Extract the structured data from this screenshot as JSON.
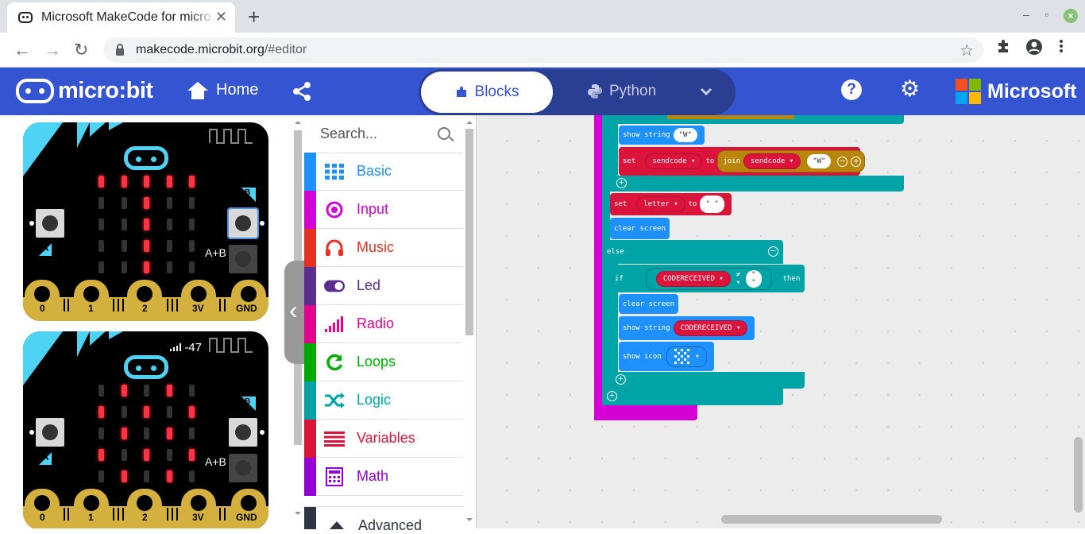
{
  "browser": {
    "tab_title": "Microsoft MakeCode for micro:bit",
    "tab_close": "✕",
    "new_tab": "+",
    "url_host": "makecode.microbit.org",
    "url_path": "/#editor",
    "window_controls": [
      "–",
      "▫"
    ]
  },
  "header": {
    "logo_text": "micro:bit",
    "home_label": "Home",
    "mode_blocks": "Blocks",
    "mode_python": "Python",
    "help": "?",
    "brand": "Microsoft",
    "brand_colors": [
      "#f25022",
      "#7fba00",
      "#00a4ef",
      "#ffb900"
    ],
    "accent": "#3454d1"
  },
  "simulator": {
    "boards": [
      {
        "pins": [
          "0",
          "1",
          "2",
          "3V",
          "GND"
        ],
        "a_label": "A",
        "b_label": "B",
        "ab_label": "A+B",
        "signal": ""
      },
      {
        "pins": [
          "0",
          "1",
          "2",
          "3V",
          "GND"
        ],
        "a_label": "A",
        "b_label": "B",
        "ab_label": "A+B",
        "signal": "-47"
      }
    ]
  },
  "toolbox": {
    "search_placeholder": "Search...",
    "categories": [
      {
        "label": "Basic",
        "color": "#1e90ff",
        "icon": "grid-icon"
      },
      {
        "label": "Input",
        "color": "#d400d4",
        "icon": "target-icon"
      },
      {
        "label": "Music",
        "color": "#e63022",
        "icon": "headphones-icon"
      },
      {
        "label": "Led",
        "color": "#5c2d91",
        "icon": "toggle-icon"
      },
      {
        "label": "Radio",
        "color": "#e3008c",
        "icon": "signal-bars-icon"
      },
      {
        "label": "Loops",
        "color": "#00aa00",
        "icon": "refresh-icon"
      },
      {
        "label": "Logic",
        "color": "#00a4a6",
        "icon": "shuffle-icon"
      },
      {
        "label": "Variables",
        "color": "#dc143c",
        "icon": "list-icon"
      },
      {
        "label": "Math",
        "color": "#9400d3",
        "icon": "calculator-icon"
      }
    ],
    "advanced_label": "Advanced"
  },
  "blocks": {
    "show_string_1": "show string",
    "w_value": "\"W\"",
    "set_label": "set",
    "sendcode_var": "sendcode",
    "to_label": "to",
    "join_label": "join",
    "letter_var": "letter",
    "empty_string": "\" \"",
    "clear_screen": "clear screen",
    "else_label": "else",
    "if_label": "if",
    "codereceived_var": "CODERECEIVED",
    "neq_op": "≠",
    "then_label": "then",
    "show_string_2": "show string",
    "show_icon": "show icon",
    "colors": {
      "logic": "#00a4a6",
      "basic": "#1e90ff",
      "variables": "#dc143c",
      "text": "#b8860b",
      "loops": "#d400d4"
    }
  }
}
